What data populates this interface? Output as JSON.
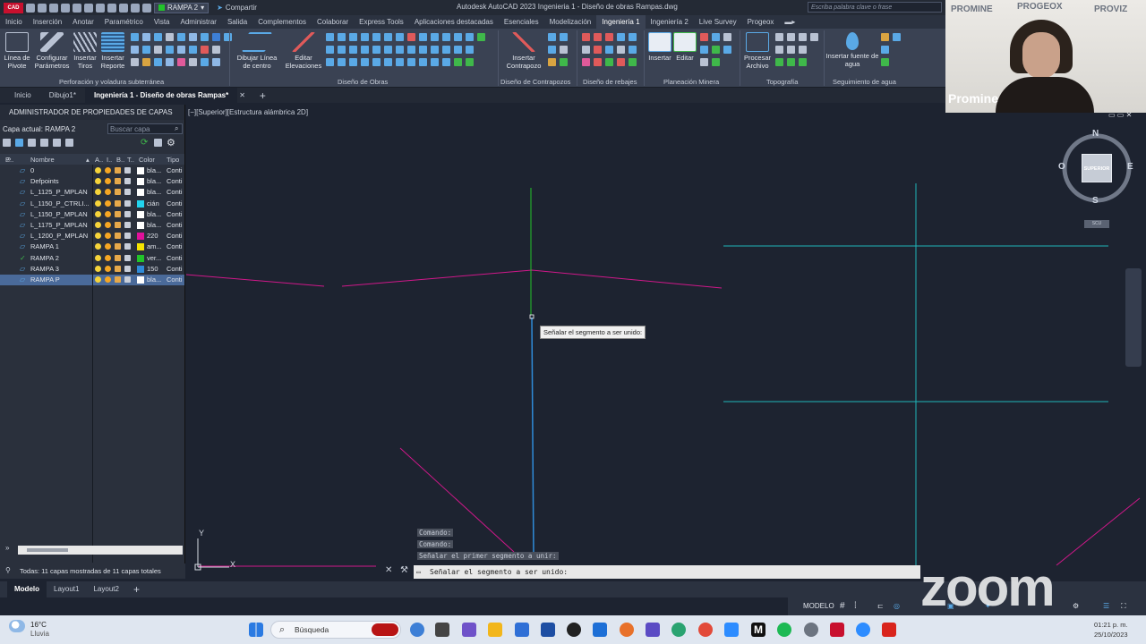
{
  "titlebar": {
    "app_logo": "CAD",
    "current_layer": "RAMPA 2",
    "share_label": "Compartir",
    "title": "Autodesk AutoCAD 2023   Ingenieria 1 - Diseño de obras Rampas.dwg",
    "search_placeholder": "Escriba palabra clave o frase"
  },
  "ribbon_tabs": [
    "Inicio",
    "Inserción",
    "Anotar",
    "Paramétrico",
    "Vista",
    "Administrar",
    "Salida",
    "Complementos",
    "Colaborar",
    "Express Tools",
    "Aplicaciones destacadas",
    "Esenciales",
    "Modelización",
    "Ingeniería 1",
    "Ingeniería 2",
    "Live Survey",
    "Progeox"
  ],
  "ribbon_active_tab": "Ingeniería 1",
  "ribbon": {
    "buttons": {
      "linea_pivote": "Línea de Pivote",
      "configurar_parametros": "Configurar Parámetros",
      "insertar_tiros": "Insertar Tiros",
      "insertar_reporte": "Insertar Reporte",
      "dibujar_linea": "Dibujar Línea de centro",
      "editar_elevaciones": "Editar Elevaciones",
      "insertar_contrapozo": "Insertar Contrapozo",
      "insertar": "Insertar",
      "editar": "Editar",
      "procesar_archivo": "Procesar Archivo",
      "insertar_fuente": "Insertar fuente de agua"
    },
    "panels": {
      "perforacion": "Perforación y voladura subterránea",
      "diseno_obras": "Diseño de Obras",
      "contrapozos": "Diseño de Contrapozos",
      "rebajes": "Diseño de rebajes",
      "planeacion": "Planeación Minera",
      "topografia": "Topografía",
      "seguimiento": "Seguimiento de agua"
    }
  },
  "doc_tabs": [
    "Inicio",
    "Dibujo1*",
    "Ingeniería 1 - Diseño de obras Rampas*"
  ],
  "doc_tab_active": "Ingeniería 1 - Diseño de obras Rampas*",
  "layer_panel": {
    "title": "ADMINISTRADOR DE PROPIEDADES DE CAPAS",
    "current_layer_label": "Capa actual: RAMPA 2",
    "search_placeholder": "Buscar capa",
    "headers": {
      "estado": "E..",
      "nombre": "Nombre",
      "a": "A..",
      "i": "I..",
      "b": "B..",
      "t": "T..",
      "color": "Color",
      "tipo": "Tipo"
    },
    "layers": [
      {
        "name": "0",
        "color_name": "bla...",
        "color": "#ffffff",
        "type": "Conti"
      },
      {
        "name": "Defpoints",
        "color_name": "bla...",
        "color": "#ffffff",
        "type": "Conti"
      },
      {
        "name": "L_1125_P_MPLAN",
        "color_name": "bla...",
        "color": "#ffffff",
        "type": "Conti"
      },
      {
        "name": "L_1150_P_CTRLI...",
        "color_name": "cián",
        "color": "#22d3ee",
        "type": "Conti"
      },
      {
        "name": "L_1150_P_MPLAN",
        "color_name": "bla...",
        "color": "#ffffff",
        "type": "Conti"
      },
      {
        "name": "L_1175_P_MPLAN",
        "color_name": "bla...",
        "color": "#ffffff",
        "type": "Conti"
      },
      {
        "name": "L_1200_P_MPLAN",
        "color_name": "220",
        "color": "#e0109a",
        "type": "Conti"
      },
      {
        "name": "RAMPA 1",
        "color_name": "am...",
        "color": "#f5e400",
        "type": "Conti"
      },
      {
        "name": "RAMPA 2",
        "color_name": "ver...",
        "color": "#22c32a",
        "type": "Conti"
      },
      {
        "name": "RAMPA 3",
        "color_name": "150",
        "color": "#2f8bd8",
        "type": "Conti"
      },
      {
        "name": "RAMPA P",
        "color_name": "bla...",
        "color": "#ffffff",
        "type": "Conti"
      }
    ],
    "selected_layer": "RAMPA P",
    "current_layer": "RAMPA 2",
    "status_text": "Todas: 11 capas mostradas de 11 capas totales"
  },
  "viewport": {
    "label": "[−][Superior][Estructura alámbrica 2D]",
    "tooltip": "Señalar el segmento a ser unido:",
    "viewcube": {
      "n": "N",
      "s": "S",
      "e": "E",
      "w": "O",
      "face": "SUPERIOR",
      "wcs": "SCU"
    },
    "ucs": {
      "x": "X",
      "y": "Y"
    }
  },
  "command": {
    "history": [
      "Comando:",
      "Comando:",
      "Señalar el primer segmento a unir:"
    ],
    "prompt": "Señalar el segmento a ser unido:"
  },
  "layout_tabs": [
    "Modelo",
    "Layout1",
    "Layout2"
  ],
  "layout_active": "Modelo",
  "statusbar": {
    "model_label": "MODELO"
  },
  "webcam": {
    "name": "Promine",
    "logos": [
      "PROMINE",
      "PROGEOX",
      "PROVIZ"
    ]
  },
  "zoom_watermark": "zoom",
  "taskbar": {
    "weather_temp": "16°C",
    "weather_desc": "Lluvia",
    "search_label": "Búsqueda",
    "time": "01:21 p. m.",
    "date": "25/10/2023"
  }
}
